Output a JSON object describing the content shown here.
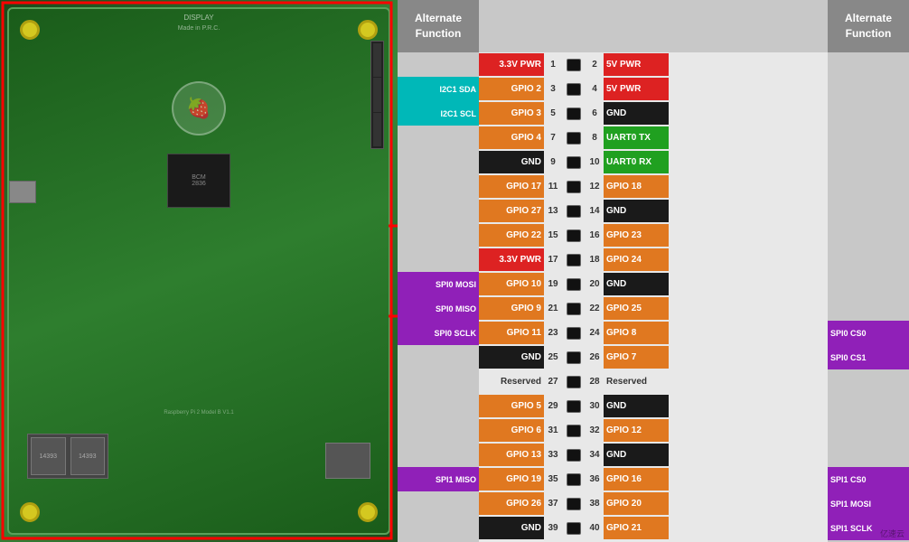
{
  "board": {
    "label": "Raspberry Pi 2 Model B V1.1",
    "made_in": "Made in P.R.C."
  },
  "gpio": {
    "left_header": "Alternate\nFunction",
    "right_header": "Alternate\nFunction",
    "pins": [
      {
        "left_alt": "",
        "left_label": "3.3V PWR",
        "left_color": "red",
        "left_num": 1,
        "right_num": 2,
        "right_label": "5V PWR",
        "right_color": "red",
        "right_alt": ""
      },
      {
        "left_alt": "I2C1 SDA",
        "left_label": "GPIO 2",
        "left_color": "orange",
        "left_num": 3,
        "right_num": 4,
        "right_label": "5V PWR",
        "right_color": "red",
        "right_alt": ""
      },
      {
        "left_alt": "I2C1 SCL",
        "left_label": "GPIO 3",
        "left_color": "orange",
        "left_num": 5,
        "right_num": 6,
        "right_label": "GND",
        "right_color": "black",
        "right_alt": ""
      },
      {
        "left_alt": "",
        "left_label": "GPIO 4",
        "left_color": "orange",
        "left_num": 7,
        "right_num": 8,
        "right_label": "UART0 TX",
        "right_color": "green",
        "right_alt": ""
      },
      {
        "left_alt": "",
        "left_label": "GND",
        "left_color": "black",
        "left_num": 9,
        "right_num": 10,
        "right_label": "UART0 RX",
        "right_color": "green",
        "right_alt": ""
      },
      {
        "left_alt": "",
        "left_label": "GPIO 17",
        "left_color": "orange",
        "left_num": 11,
        "right_num": 12,
        "right_label": "GPIO 18",
        "right_color": "orange",
        "right_alt": ""
      },
      {
        "left_alt": "",
        "left_label": "GPIO 27",
        "left_color": "orange",
        "left_num": 13,
        "right_num": 14,
        "right_label": "GND",
        "right_color": "black",
        "right_alt": ""
      },
      {
        "left_alt": "",
        "left_label": "GPIO 22",
        "left_color": "orange",
        "left_num": 15,
        "right_num": 16,
        "right_label": "GPIO 23",
        "right_color": "orange",
        "right_alt": ""
      },
      {
        "left_alt": "",
        "left_label": "3.3V PWR",
        "left_color": "red",
        "left_num": 17,
        "right_num": 18,
        "right_label": "GPIO 24",
        "right_color": "orange",
        "right_alt": ""
      },
      {
        "left_alt": "SPI0 MOSI",
        "left_label": "GPIO 10",
        "left_color": "orange",
        "left_num": 19,
        "right_num": 20,
        "right_label": "GND",
        "right_color": "black",
        "right_alt": ""
      },
      {
        "left_alt": "SPI0 MISO",
        "left_label": "GPIO 9",
        "left_color": "orange",
        "left_num": 21,
        "right_num": 22,
        "right_label": "GPIO 25",
        "right_color": "orange",
        "right_alt": ""
      },
      {
        "left_alt": "SPI0 SCLK",
        "left_label": "GPIO 11",
        "left_color": "orange",
        "left_num": 23,
        "right_num": 24,
        "right_label": "GPIO 8",
        "right_color": "orange",
        "right_alt": "SPI0 CS0"
      },
      {
        "left_alt": "",
        "left_label": "GND",
        "left_color": "black",
        "left_num": 25,
        "right_num": 26,
        "right_label": "GPIO 7",
        "right_color": "orange",
        "right_alt": "SPI0 CS1"
      },
      {
        "left_alt": "",
        "left_label": "Reserved",
        "left_color": "none",
        "left_num": 27,
        "right_num": 28,
        "right_label": "Reserved",
        "right_color": "none",
        "right_alt": ""
      },
      {
        "left_alt": "",
        "left_label": "GPIO 5",
        "left_color": "orange",
        "left_num": 29,
        "right_num": 30,
        "right_label": "GND",
        "right_color": "black",
        "right_alt": ""
      },
      {
        "left_alt": "",
        "left_label": "GPIO 6",
        "left_color": "orange",
        "left_num": 31,
        "right_num": 32,
        "right_label": "GPIO 12",
        "right_color": "orange",
        "right_alt": ""
      },
      {
        "left_alt": "",
        "left_label": "GPIO 13",
        "left_color": "orange",
        "left_num": 33,
        "right_num": 34,
        "right_label": "GND",
        "right_color": "black",
        "right_alt": ""
      },
      {
        "left_alt": "SPI1 MISO",
        "left_label": "GPIO 19",
        "left_color": "orange",
        "left_num": 35,
        "right_num": 36,
        "right_label": "GPIO 16",
        "right_color": "orange",
        "right_alt": "SPI1 CS0"
      },
      {
        "left_alt": "",
        "left_label": "GPIO 26",
        "left_color": "orange",
        "left_num": 37,
        "right_num": 38,
        "right_label": "GPIO 20",
        "right_color": "orange",
        "right_alt": "SPI1 MOSI"
      },
      {
        "left_alt": "",
        "left_label": "GND",
        "left_color": "black",
        "left_num": 39,
        "right_num": 40,
        "right_label": "GPIO 21",
        "right_color": "orange",
        "right_alt": "SPI1 SCLK"
      }
    ]
  },
  "watermark": "亿速云"
}
